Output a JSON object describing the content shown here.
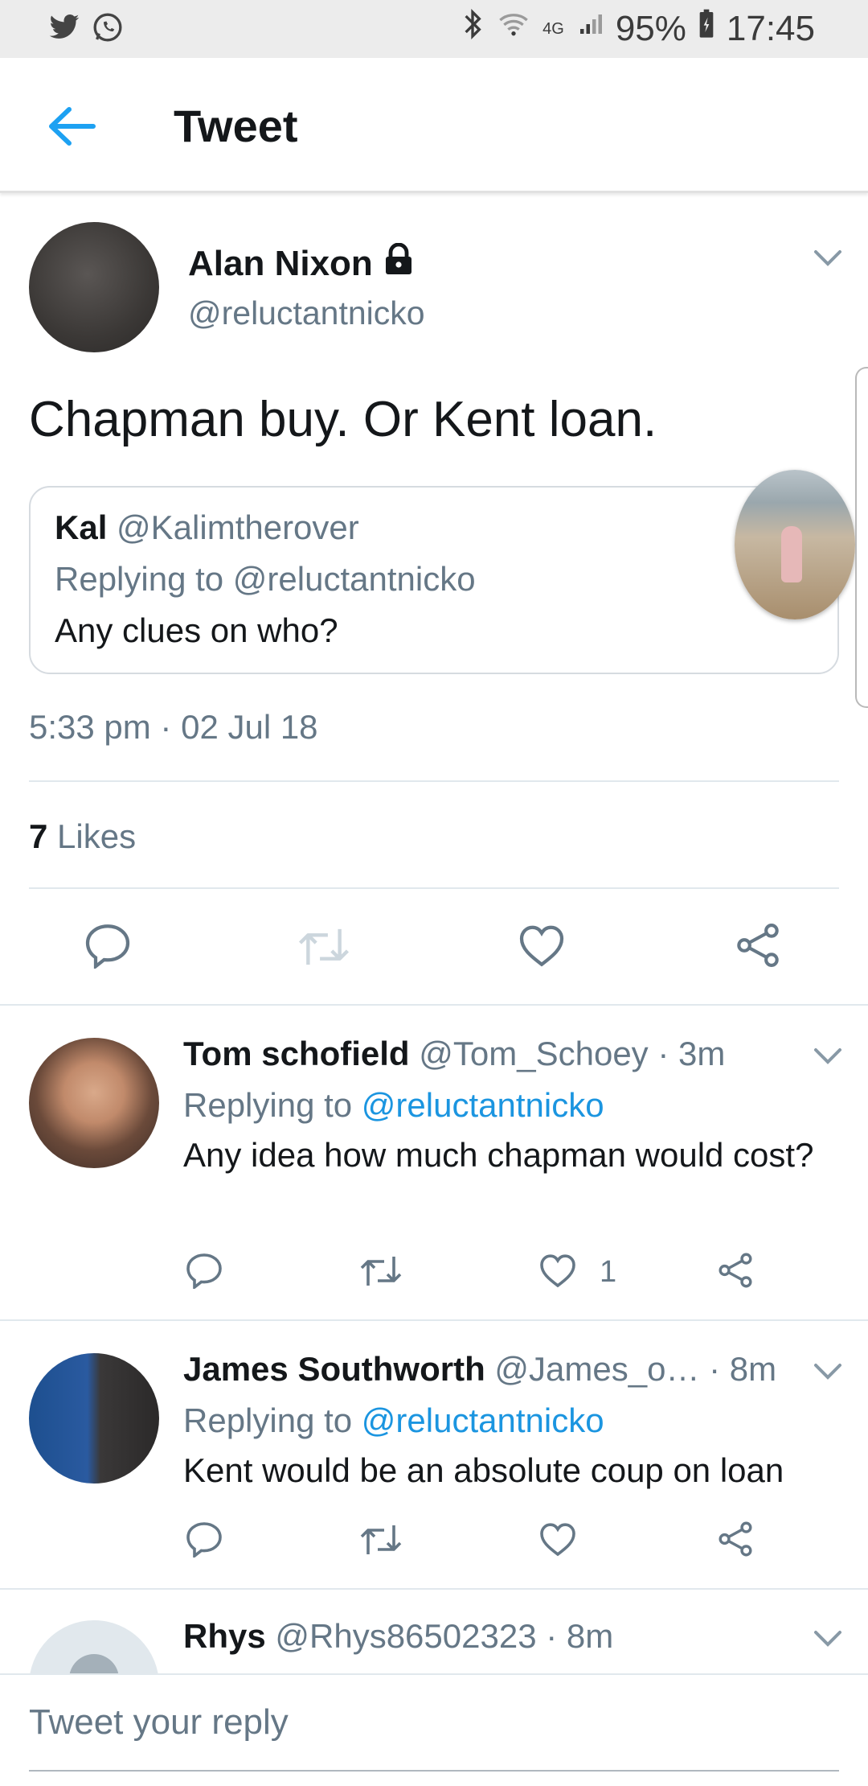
{
  "status_bar": {
    "battery": "95%",
    "time": "17:45",
    "network": "4G"
  },
  "header": {
    "title": "Tweet"
  },
  "tweet": {
    "author_name": "Alan Nixon",
    "author_handle": "@reluctantnicko",
    "text": "Chapman buy. Or Kent loan.",
    "quoted": {
      "name": "Kal",
      "handle": "@Kalimtherover",
      "replying_to": "Replying to @reluctantnicko",
      "text": "Any clues on who?"
    },
    "timestamp": "5:33 pm · 02 Jul 18",
    "likes_count": "7",
    "likes_label": "Likes"
  },
  "replies": [
    {
      "name": "Tom schofield",
      "meta": "@Tom_Schoey · 3m",
      "replying_label": "Replying to",
      "replying_handle": "@reluctantnicko",
      "text": "Any idea how much chapman would cost?",
      "like_count": "1"
    },
    {
      "name": "James Southworth",
      "meta": "@James_o… · 8m",
      "replying_label": "Replying to",
      "replying_handle": "@reluctantnicko",
      "text": "Kent would be an absolute coup on loan",
      "like_count": ""
    },
    {
      "name": "Rhys",
      "meta": "@Rhys86502323 · 8m"
    }
  ],
  "reply_box": {
    "placeholder": "Tweet your reply"
  },
  "colors": {
    "accent": "#1da1f2",
    "link": "#1b95e0",
    "secondary_text": "#657786",
    "icon_gray": "#657786"
  }
}
